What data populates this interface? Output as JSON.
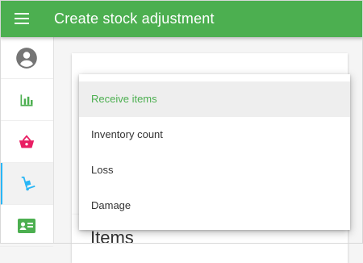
{
  "appbar": {
    "title": "Create stock adjustment"
  },
  "sidebar": {
    "items": [
      {
        "icon": "account-circle-icon",
        "color": "#757575"
      },
      {
        "icon": "bar-chart-icon",
        "color": "#4caf50"
      },
      {
        "icon": "basket-icon",
        "color": "#e91e63"
      },
      {
        "icon": "hand-truck-icon",
        "color": "#29b6f6",
        "active": true
      },
      {
        "icon": "id-card-icon",
        "color": "#4caf50"
      }
    ]
  },
  "main": {
    "items_heading": "Items"
  },
  "dropdown": {
    "options": [
      {
        "label": "Receive items",
        "selected": true,
        "color": "#4caf50"
      },
      {
        "label": "Inventory count"
      },
      {
        "label": "Loss"
      },
      {
        "label": "Damage"
      }
    ]
  }
}
